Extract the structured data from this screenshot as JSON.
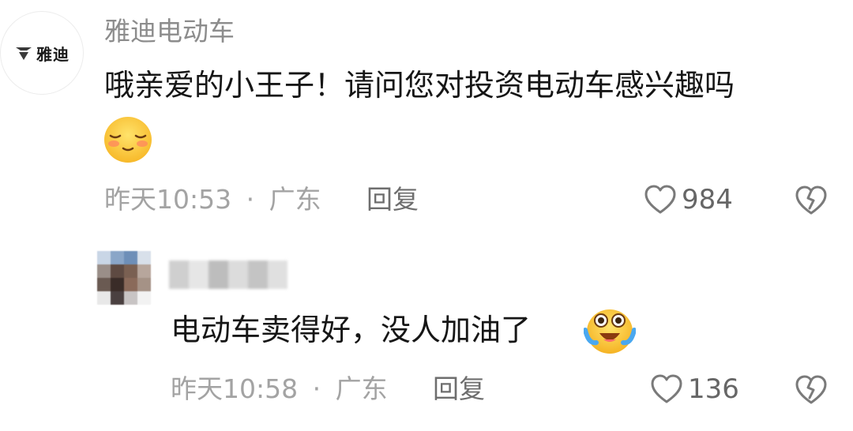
{
  "comments": [
    {
      "author": "雅迪电动车",
      "avatar_text": "雅迪",
      "text": "哦亲爱的小王子！请问您对投资电动车感兴趣吗",
      "emoji": "shy-smile-emoji",
      "time": "昨天10:53",
      "location": "广东",
      "separator": "·",
      "reply_label": "回复",
      "likes": "984"
    },
    {
      "author": "",
      "author_blurred": true,
      "text": "电动车卖得好，没人加油了",
      "emoji": "crying-laughing-emoji",
      "time": "昨天10:58",
      "location": "广东",
      "separator": "·",
      "reply_label": "回复",
      "likes": "136"
    }
  ],
  "icons": {
    "like": "heart-outline-icon",
    "dislike": "broken-heart-icon"
  },
  "colors": {
    "text_primary": "#161616",
    "text_secondary": "#a3a3a3",
    "username": "#8c8c8c",
    "background": "#ffffff"
  }
}
